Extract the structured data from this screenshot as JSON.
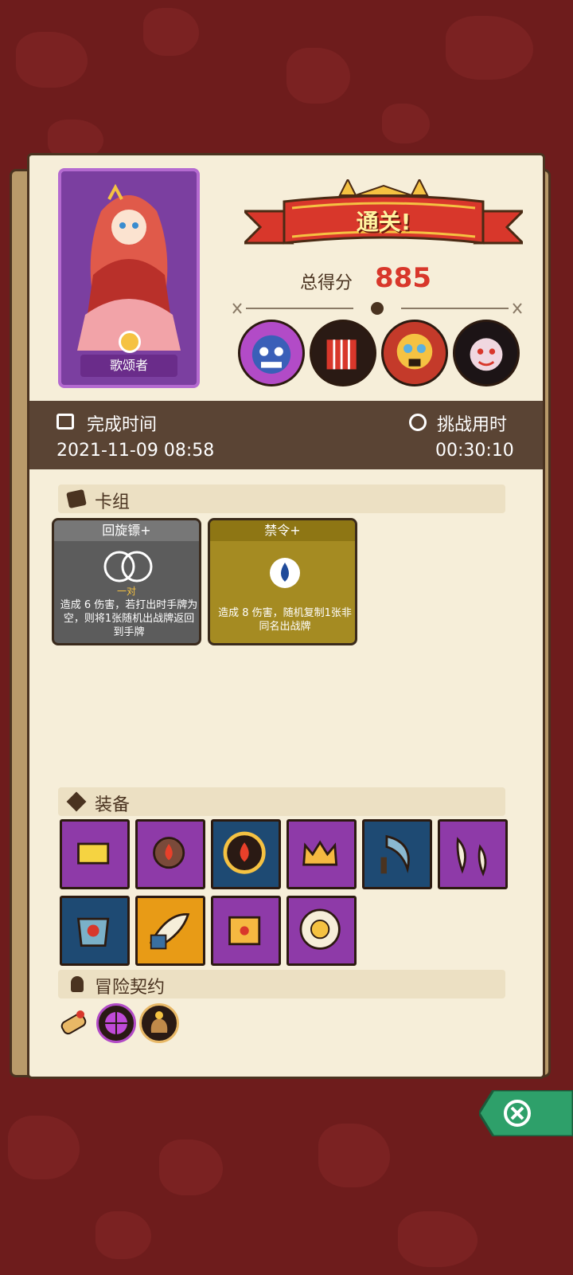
{
  "banner": {
    "title": "通关!"
  },
  "score": {
    "label": "总得分",
    "value": "885"
  },
  "character": {
    "name": "歌颂者"
  },
  "info": {
    "finish_label": "完成时间",
    "finish_value": "2021-11-09 08:58",
    "duration_label": "挑战用时",
    "duration_value": "00:30:10"
  },
  "deck": {
    "title": "卡组",
    "cards": [
      {
        "name": "回旋镖+",
        "tag": "一对",
        "desc": "造成 6 伤害，若打出时手牌为空，则将1张随机出战牌返回到手牌",
        "color": "#5c5c5c"
      },
      {
        "name": "禁令+",
        "tag": "",
        "desc": "造成 8 伤害，随机复制1张非同名出战牌",
        "color": "#a58b22"
      }
    ]
  },
  "equipment": {
    "title": "装备",
    "items": [
      {
        "icon": "gold-bars-icon",
        "color": "#8e3aa8"
      },
      {
        "icon": "flame-stone-icon",
        "color": "#8e3aa8"
      },
      {
        "icon": "fire-emblem-icon",
        "color": "#1e4a73"
      },
      {
        "icon": "crown-icon",
        "color": "#8e3aa8"
      },
      {
        "icon": "sickle-icon",
        "color": "#1e4a73"
      },
      {
        "icon": "fangs-icon",
        "color": "#8e3aa8"
      },
      {
        "icon": "armor-icon",
        "color": "#1e4a73"
      },
      {
        "icon": "horn-icon",
        "color": "#e89b16"
      },
      {
        "icon": "spellbook-icon",
        "color": "#8e3aa8"
      },
      {
        "icon": "sun-shield-icon",
        "color": "#8e3aa8"
      }
    ]
  },
  "contracts": {
    "title": "冒险契约",
    "items": [
      {
        "icon": "scroll-icon"
      },
      {
        "icon": "globe-icon"
      },
      {
        "icon": "sack-icon"
      }
    ]
  },
  "colors": {
    "accent": "#d8372b",
    "panel": "#f6eed9",
    "bar": "#5a4434",
    "close": "#2ea06a"
  }
}
